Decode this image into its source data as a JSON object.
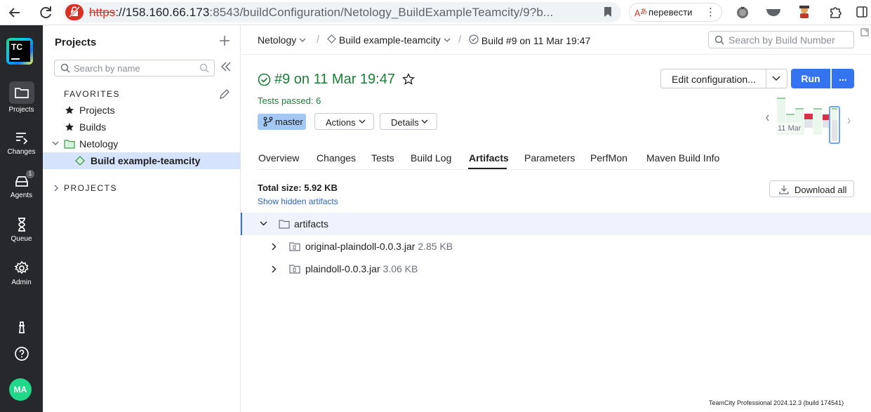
{
  "browser": {
    "url_scheme": "https",
    "url_host": "://158.160.66.173",
    "url_port_path": ":8543/buildConfiguration/Netology_BuildExampleTeamcity/9?b...",
    "translate_label": "перевести"
  },
  "rail": {
    "logo_text": "TC",
    "items": [
      {
        "label": "Projects"
      },
      {
        "label": "Changes"
      },
      {
        "label": "Agents",
        "badge": "1"
      },
      {
        "label": "Queue"
      },
      {
        "label": "Admin"
      }
    ],
    "avatar": "MA"
  },
  "projects_panel": {
    "title": "Projects",
    "search_placeholder": "Search by name",
    "favorites_label": "FAVORITES",
    "favorites": [
      "Projects",
      "Builds"
    ],
    "tree_project": "Netology",
    "tree_build": "Build example-teamcity",
    "projects_label": "PROJECTS"
  },
  "breadcrumb": {
    "project": "Netology",
    "build_config": "Build example-teamcity",
    "build": "Build #9 on 11 Mar 19:47",
    "search_placeholder": "Search by Build Number"
  },
  "build": {
    "title": "#9 on 11 Mar 19:47",
    "tests_passed": "Tests passed: 6",
    "branch": "master",
    "actions_label": "Actions",
    "details_label": "Details",
    "edit_config_label": "Edit configuration...",
    "run_label": "Run",
    "run_more_label": "...",
    "chart_date_label": "11 Mar"
  },
  "tabs": [
    "Overview",
    "Changes",
    "Tests",
    "Build Log",
    "Artifacts",
    "Parameters",
    "PerfMon",
    "Maven Build Info"
  ],
  "active_tab": "Artifacts",
  "artifacts": {
    "total_size": "Total size: 5.92 KB",
    "show_hidden": "Show hidden artifacts",
    "download_all": "Download all",
    "root": "artifacts",
    "files": [
      {
        "name": "original-plaindoll-0.0.3.jar",
        "size": "2.85 KB"
      },
      {
        "name": "plaindoll-0.0.3.jar",
        "size": "3.06 KB"
      }
    ]
  },
  "footer": "TeamCity Professional 2024.12.3 (build 174541)",
  "colors": {
    "success": "#1a7f37",
    "primary": "#3574f0",
    "rail_bg": "#27282c",
    "selected_bg": "#d5e3fc"
  }
}
